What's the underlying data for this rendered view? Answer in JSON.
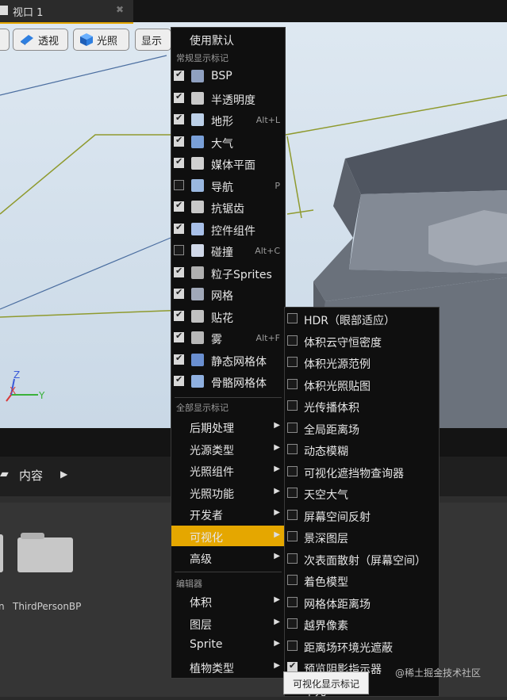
{
  "viewport": {
    "tab_title": "视口 1",
    "toolbar": {
      "perspective_label": "透视",
      "lighting_label": "光照",
      "show_label": "显示"
    },
    "axis": {
      "x": "X",
      "y": "Y",
      "z": "Z"
    }
  },
  "content_browser": {
    "tab_label": "内容",
    "folder_name": "ThirdPersonBP"
  },
  "show_menu": {
    "use_defaults": "使用默认",
    "common_header": "常规显示标记",
    "common_items": [
      {
        "label": "BSP",
        "checked": true,
        "shortcut": ""
      },
      {
        "label": "半透明度",
        "checked": true,
        "shortcut": ""
      },
      {
        "label": "地形",
        "checked": true,
        "shortcut": "Alt+L"
      },
      {
        "label": "大气",
        "checked": true,
        "shortcut": ""
      },
      {
        "label": "媒体平面",
        "checked": true,
        "shortcut": ""
      },
      {
        "label": "导航",
        "checked": false,
        "shortcut": "P"
      },
      {
        "label": "抗锯齿",
        "checked": true,
        "shortcut": ""
      },
      {
        "label": "控件组件",
        "checked": true,
        "shortcut": ""
      },
      {
        "label": "碰撞",
        "checked": false,
        "shortcut": "Alt+C"
      },
      {
        "label": "粒子Sprites",
        "checked": true,
        "shortcut": ""
      },
      {
        "label": "网格",
        "checked": true,
        "shortcut": ""
      },
      {
        "label": "贴花",
        "checked": true,
        "shortcut": ""
      },
      {
        "label": "雾",
        "checked": true,
        "shortcut": "Alt+F"
      },
      {
        "label": "静态网格体",
        "checked": true,
        "shortcut": ""
      },
      {
        "label": "骨骼网格体",
        "checked": true,
        "shortcut": ""
      }
    ],
    "all_header": "全部显示标记",
    "all_items": [
      "后期处理",
      "光源类型",
      "光照组件",
      "光照功能",
      "开发者",
      "可视化",
      "高级"
    ],
    "active_item": "可视化",
    "editor_header": "编辑器",
    "editor_items": [
      "体积",
      "图层",
      "Sprite",
      "植物类型"
    ]
  },
  "visualize_submenu": {
    "items": [
      {
        "label": "HDR（眼部适应）",
        "checked": false
      },
      {
        "label": "体积云守恒密度",
        "checked": false
      },
      {
        "label": "体积光源范例",
        "checked": false
      },
      {
        "label": "体积光照贴图",
        "checked": false
      },
      {
        "label": "光传播体积",
        "checked": false
      },
      {
        "label": "全局距离场",
        "checked": false
      },
      {
        "label": "动态模糊",
        "checked": false
      },
      {
        "label": "可视化遮挡物查询器",
        "checked": false
      },
      {
        "label": "天空大气",
        "checked": false
      },
      {
        "label": "屏幕空间反射",
        "checked": false
      },
      {
        "label": "景深图层",
        "checked": false
      },
      {
        "label": "次表面散射（屏幕空间）",
        "checked": false
      },
      {
        "label": "着色模型",
        "checked": false
      },
      {
        "label": "网格体距离场",
        "checked": false
      },
      {
        "label": "越界像素",
        "checked": false
      },
      {
        "label": "距离场环境光遮蔽",
        "checked": false
      },
      {
        "label": "预览阴影指示器",
        "checked": true
      },
      {
        "label": "单元",
        "checked": false
      }
    ]
  },
  "tooltip": "可视化显示标记",
  "watermark": "@稀土掘金技术社区",
  "colors": {
    "accent": "#e5a700",
    "menu_bg": "#0f0f0f"
  }
}
